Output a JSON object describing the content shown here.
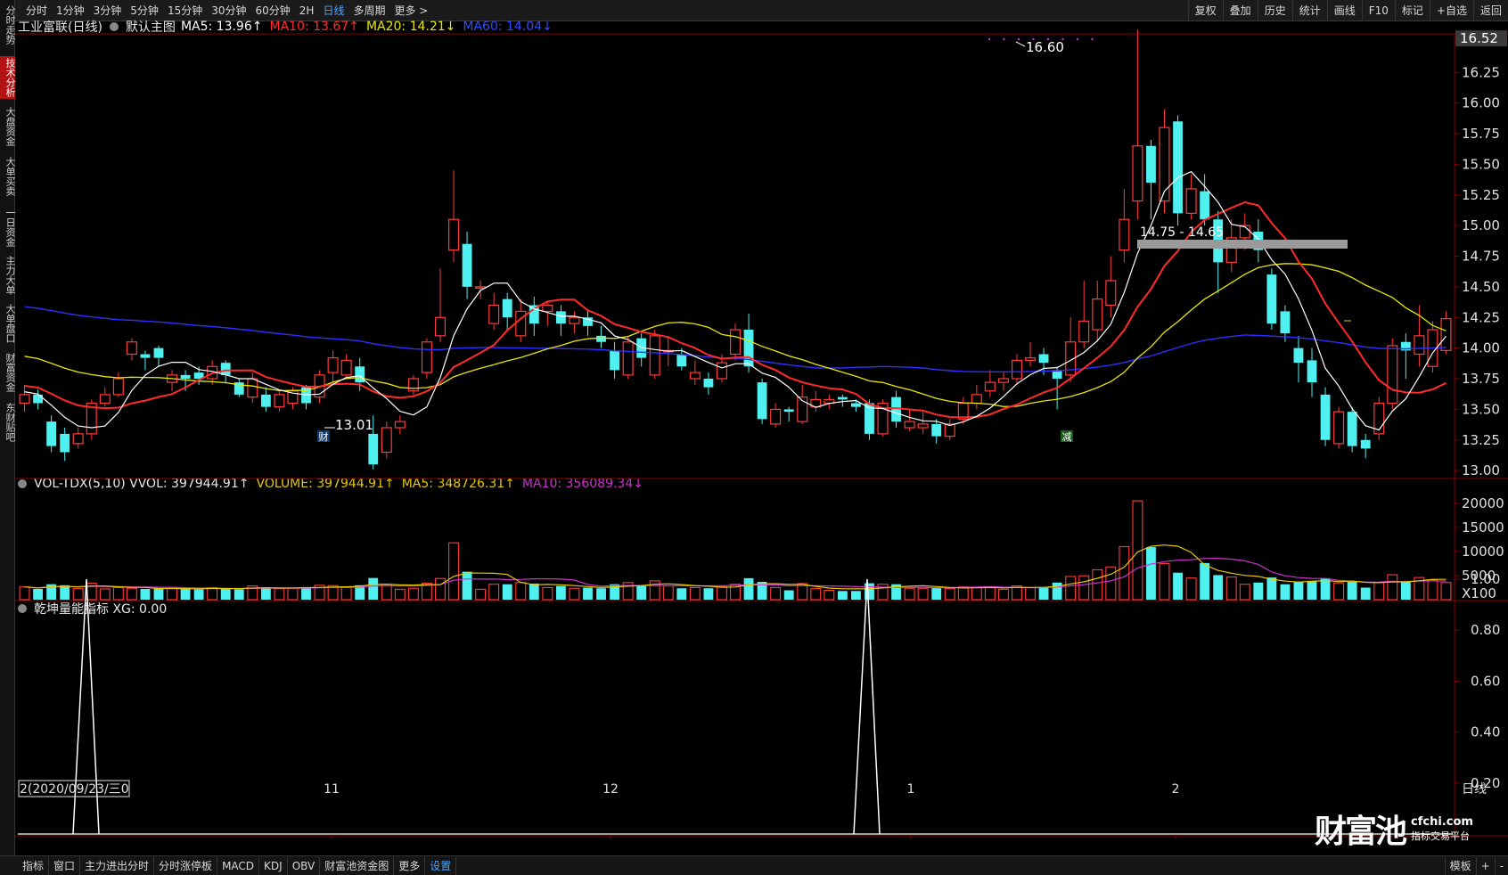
{
  "topbar": {
    "tabs": [
      "分时",
      "1分钟",
      "3分钟",
      "5分钟",
      "15分钟",
      "30分钟",
      "60分钟",
      "2H",
      "日线",
      "多周期",
      "更多 >"
    ],
    "active_tab": "日线",
    "tools": [
      "复权",
      "叠加",
      "历史",
      "统计",
      "画线",
      "F10",
      "标记",
      "+自选",
      "返回"
    ]
  },
  "leftnav": [
    "分时走势",
    "技术分析",
    "大盘资金",
    "大单买卖",
    "一日资金",
    "主力大单",
    "大单盘口",
    "财富资金",
    "东财贴吧"
  ],
  "leftnav_active": "技术分析",
  "main_legend": {
    "stock": "工业富联(日线)",
    "main_chart": "默认主图",
    "ma5": "MA5: 13.96↑",
    "ma10": "MA10: 13.67↑",
    "ma20": "MA20: 14.21↓",
    "ma60": "MA60: 14.04↓",
    "colors": {
      "ma5": "#ffffff",
      "ma10": "#ff2a2a",
      "ma20": "#e8e800",
      "ma60": "#2f2fff"
    }
  },
  "vol_legend": {
    "title": "VOL-TDX(5,10) VVOL: 397944.91↑",
    "volume": "VOLUME: 397944.91↑",
    "ma5": "MA5: 348726.31↑",
    "ma10": "MA10: 356089.34↓",
    "colors": {
      "volume": "#e8c800",
      "ma5": "#e8c800",
      "ma10": "#cc33cc"
    }
  },
  "ind_legend": {
    "title": "乾坤量能指标 XG: 0.00"
  },
  "price_axis": [
    "16.52",
    "16.25",
    "16.00",
    "15.75",
    "15.50",
    "15.25",
    "15.00",
    "14.75",
    "14.50",
    "14.25",
    "14.00",
    "13.75",
    "13.50",
    "13.25",
    "13.00"
  ],
  "vol_axis": [
    "20000",
    "15000",
    "10000",
    "5000",
    "X100"
  ],
  "ind_axis": [
    "1.00",
    "0.80",
    "0.60",
    "0.40",
    "0.20"
  ],
  "annotations": {
    "high": "16.60",
    "low": "13.01",
    "range": "14.75 - 14.65",
    "marker_cai": "财",
    "marker_jian": "减"
  },
  "x_axis": {
    "first": "2(2020/09/23/三0",
    "labels": [
      "11",
      "12",
      "1",
      "2"
    ],
    "period": "日线"
  },
  "bottombar": {
    "tabs": [
      "指标",
      "窗口",
      "主力进出分时",
      "分时涨停板",
      "MACD",
      "KDJ",
      "OBV",
      "财富池资金图",
      "更多",
      "设置"
    ],
    "active": "设置",
    "right": [
      "模板",
      "+",
      "-"
    ]
  },
  "watermark": {
    "logo": "财富池",
    "url": "cfchi.com",
    "sub": "指标交易平台"
  },
  "chart_data": {
    "type": "candlestick",
    "title": "工业富联(日线)",
    "price_range": [
      12.95,
      16.55
    ],
    "candles": [
      [
        13.55,
        13.62,
        13.7,
        13.48
      ],
      [
        13.62,
        13.55,
        13.66,
        13.5
      ],
      [
        13.4,
        13.2,
        13.45,
        13.15
      ],
      [
        13.3,
        13.15,
        13.35,
        13.08
      ],
      [
        13.22,
        13.3,
        13.35,
        13.18
      ],
      [
        13.3,
        13.55,
        13.58,
        13.25
      ],
      [
        13.55,
        13.62,
        13.68,
        13.52
      ],
      [
        13.62,
        13.75,
        13.8,
        13.6
      ],
      [
        13.95,
        14.05,
        14.08,
        13.9
      ],
      [
        13.95,
        13.92,
        13.98,
        13.82
      ],
      [
        14.0,
        13.92,
        14.02,
        13.85
      ],
      [
        13.72,
        13.78,
        13.82,
        13.65
      ],
      [
        13.78,
        13.75,
        13.82,
        13.65
      ],
      [
        13.8,
        13.75,
        13.85,
        13.7
      ],
      [
        13.75,
        13.85,
        13.9,
        13.7
      ],
      [
        13.88,
        13.78,
        13.9,
        13.72
      ],
      [
        13.72,
        13.62,
        13.75,
        13.6
      ],
      [
        13.6,
        13.75,
        13.8,
        13.55
      ],
      [
        13.62,
        13.52,
        13.68,
        13.48
      ],
      [
        13.52,
        13.62,
        13.65,
        13.48
      ],
      [
        13.55,
        13.65,
        13.68,
        13.5
      ],
      [
        13.68,
        13.55,
        13.7,
        13.5
      ],
      [
        13.6,
        13.78,
        13.82,
        13.55
      ],
      [
        13.8,
        13.92,
        13.98,
        13.72
      ],
      [
        13.78,
        13.9,
        13.95,
        13.75
      ],
      [
        13.85,
        13.72,
        13.92,
        13.65
      ],
      [
        13.3,
        13.05,
        13.45,
        13.01
      ],
      [
        13.15,
        13.35,
        13.4,
        13.1
      ],
      [
        13.35,
        13.4,
        13.45,
        13.3
      ],
      [
        13.65,
        13.75,
        13.78,
        13.6
      ],
      [
        13.8,
        14.05,
        14.08,
        13.75
      ],
      [
        14.1,
        14.25,
        14.65,
        14.05
      ],
      [
        14.8,
        15.05,
        15.45,
        14.7
      ],
      [
        14.85,
        14.5,
        14.95,
        14.4
      ],
      [
        14.5,
        14.5,
        14.55,
        14.4
      ],
      [
        14.2,
        14.35,
        14.45,
        14.15
      ],
      [
        14.4,
        14.25,
        14.45,
        14.15
      ],
      [
        14.1,
        14.3,
        14.4,
        14.05
      ],
      [
        14.35,
        14.2,
        14.42,
        14.1
      ],
      [
        14.3,
        14.35,
        14.38,
        14.18
      ],
      [
        14.3,
        14.2,
        14.35,
        14.1
      ],
      [
        14.2,
        14.25,
        14.3,
        14.12
      ],
      [
        14.25,
        14.18,
        14.3,
        14.1
      ],
      [
        14.1,
        14.05,
        14.18,
        14.0
      ],
      [
        13.98,
        13.82,
        14.05,
        13.75
      ],
      [
        13.78,
        14.05,
        14.1,
        13.75
      ],
      [
        14.08,
        13.92,
        14.12,
        13.85
      ],
      [
        13.78,
        14.1,
        14.15,
        13.75
      ],
      [
        13.98,
        13.98,
        14.1,
        13.85
      ],
      [
        13.95,
        13.85,
        14.0,
        13.82
      ],
      [
        13.75,
        13.8,
        13.9,
        13.7
      ],
      [
        13.75,
        13.68,
        13.8,
        13.62
      ],
      [
        13.75,
        13.88,
        13.95,
        13.72
      ],
      [
        13.95,
        14.15,
        14.2,
        13.9
      ],
      [
        14.15,
        13.85,
        14.28,
        13.8
      ],
      [
        13.72,
        13.42,
        13.75,
        13.38
      ],
      [
        13.38,
        13.5,
        13.55,
        13.35
      ],
      [
        13.5,
        13.48,
        13.52,
        13.4
      ],
      [
        13.4,
        13.6,
        13.7,
        13.38
      ],
      [
        13.52,
        13.58,
        13.65,
        13.48
      ],
      [
        13.55,
        13.58,
        13.62,
        13.5
      ],
      [
        13.6,
        13.58,
        13.62,
        13.52
      ],
      [
        13.55,
        13.52,
        13.58,
        13.48
      ],
      [
        13.55,
        13.3,
        13.58,
        13.25
      ],
      [
        13.3,
        13.55,
        13.58,
        13.28
      ],
      [
        13.6,
        13.4,
        13.65,
        13.35
      ],
      [
        13.35,
        13.4,
        13.5,
        13.32
      ],
      [
        13.35,
        13.38,
        13.48,
        13.3
      ],
      [
        13.38,
        13.28,
        13.42,
        13.22
      ],
      [
        13.28,
        13.38,
        13.42,
        13.25
      ],
      [
        13.42,
        13.55,
        13.6,
        13.38
      ],
      [
        13.55,
        13.62,
        13.7,
        13.5
      ],
      [
        13.65,
        13.72,
        13.82,
        13.6
      ],
      [
        13.72,
        13.75,
        13.8,
        13.65
      ],
      [
        13.75,
        13.9,
        13.95,
        13.7
      ],
      [
        13.9,
        13.92,
        14.05,
        13.85
      ],
      [
        13.95,
        13.88,
        14.0,
        13.78
      ],
      [
        13.82,
        13.75,
        13.85,
        13.5
      ],
      [
        13.78,
        14.05,
        14.25,
        13.72
      ],
      [
        14.05,
        14.22,
        14.55,
        14.0
      ],
      [
        14.15,
        14.4,
        14.55,
        14.05
      ],
      [
        14.35,
        14.55,
        14.75,
        14.25
      ],
      [
        14.8,
        15.05,
        15.3,
        14.7
      ],
      [
        15.2,
        15.65,
        16.6,
        15.05
      ],
      [
        15.65,
        15.35,
        15.7,
        15.05
      ],
      [
        15.2,
        15.8,
        15.95,
        15.1
      ],
      [
        15.85,
        15.1,
        15.9,
        15.0
      ],
      [
        15.1,
        15.3,
        15.42,
        15.05
      ],
      [
        15.28,
        15.05,
        15.42,
        15.0
      ],
      [
        15.05,
        14.7,
        15.12,
        14.45
      ],
      [
        14.7,
        14.9,
        15.05,
        14.62
      ],
      [
        14.9,
        15.0,
        15.1,
        14.8
      ],
      [
        14.95,
        14.8,
        15.05,
        14.7
      ],
      [
        14.6,
        14.2,
        14.65,
        14.15
      ],
      [
        14.3,
        14.12,
        14.35,
        14.05
      ],
      [
        14.0,
        13.88,
        14.1,
        13.72
      ],
      [
        13.9,
        13.72,
        14.0,
        13.6
      ],
      [
        13.62,
        13.25,
        13.68,
        13.2
      ],
      [
        13.22,
        13.48,
        13.52,
        13.18
      ],
      [
        13.48,
        13.2,
        13.52,
        13.15
      ],
      [
        13.25,
        13.18,
        13.3,
        13.1
      ],
      [
        13.3,
        13.55,
        13.6,
        13.25
      ],
      [
        13.55,
        14.02,
        14.08,
        13.5
      ],
      [
        14.05,
        13.98,
        14.12,
        13.75
      ],
      [
        13.95,
        14.1,
        14.35,
        13.85
      ],
      [
        13.85,
        14.15,
        14.22,
        13.8
      ],
      [
        13.98,
        14.24,
        14.3,
        13.95
      ]
    ]
  }
}
